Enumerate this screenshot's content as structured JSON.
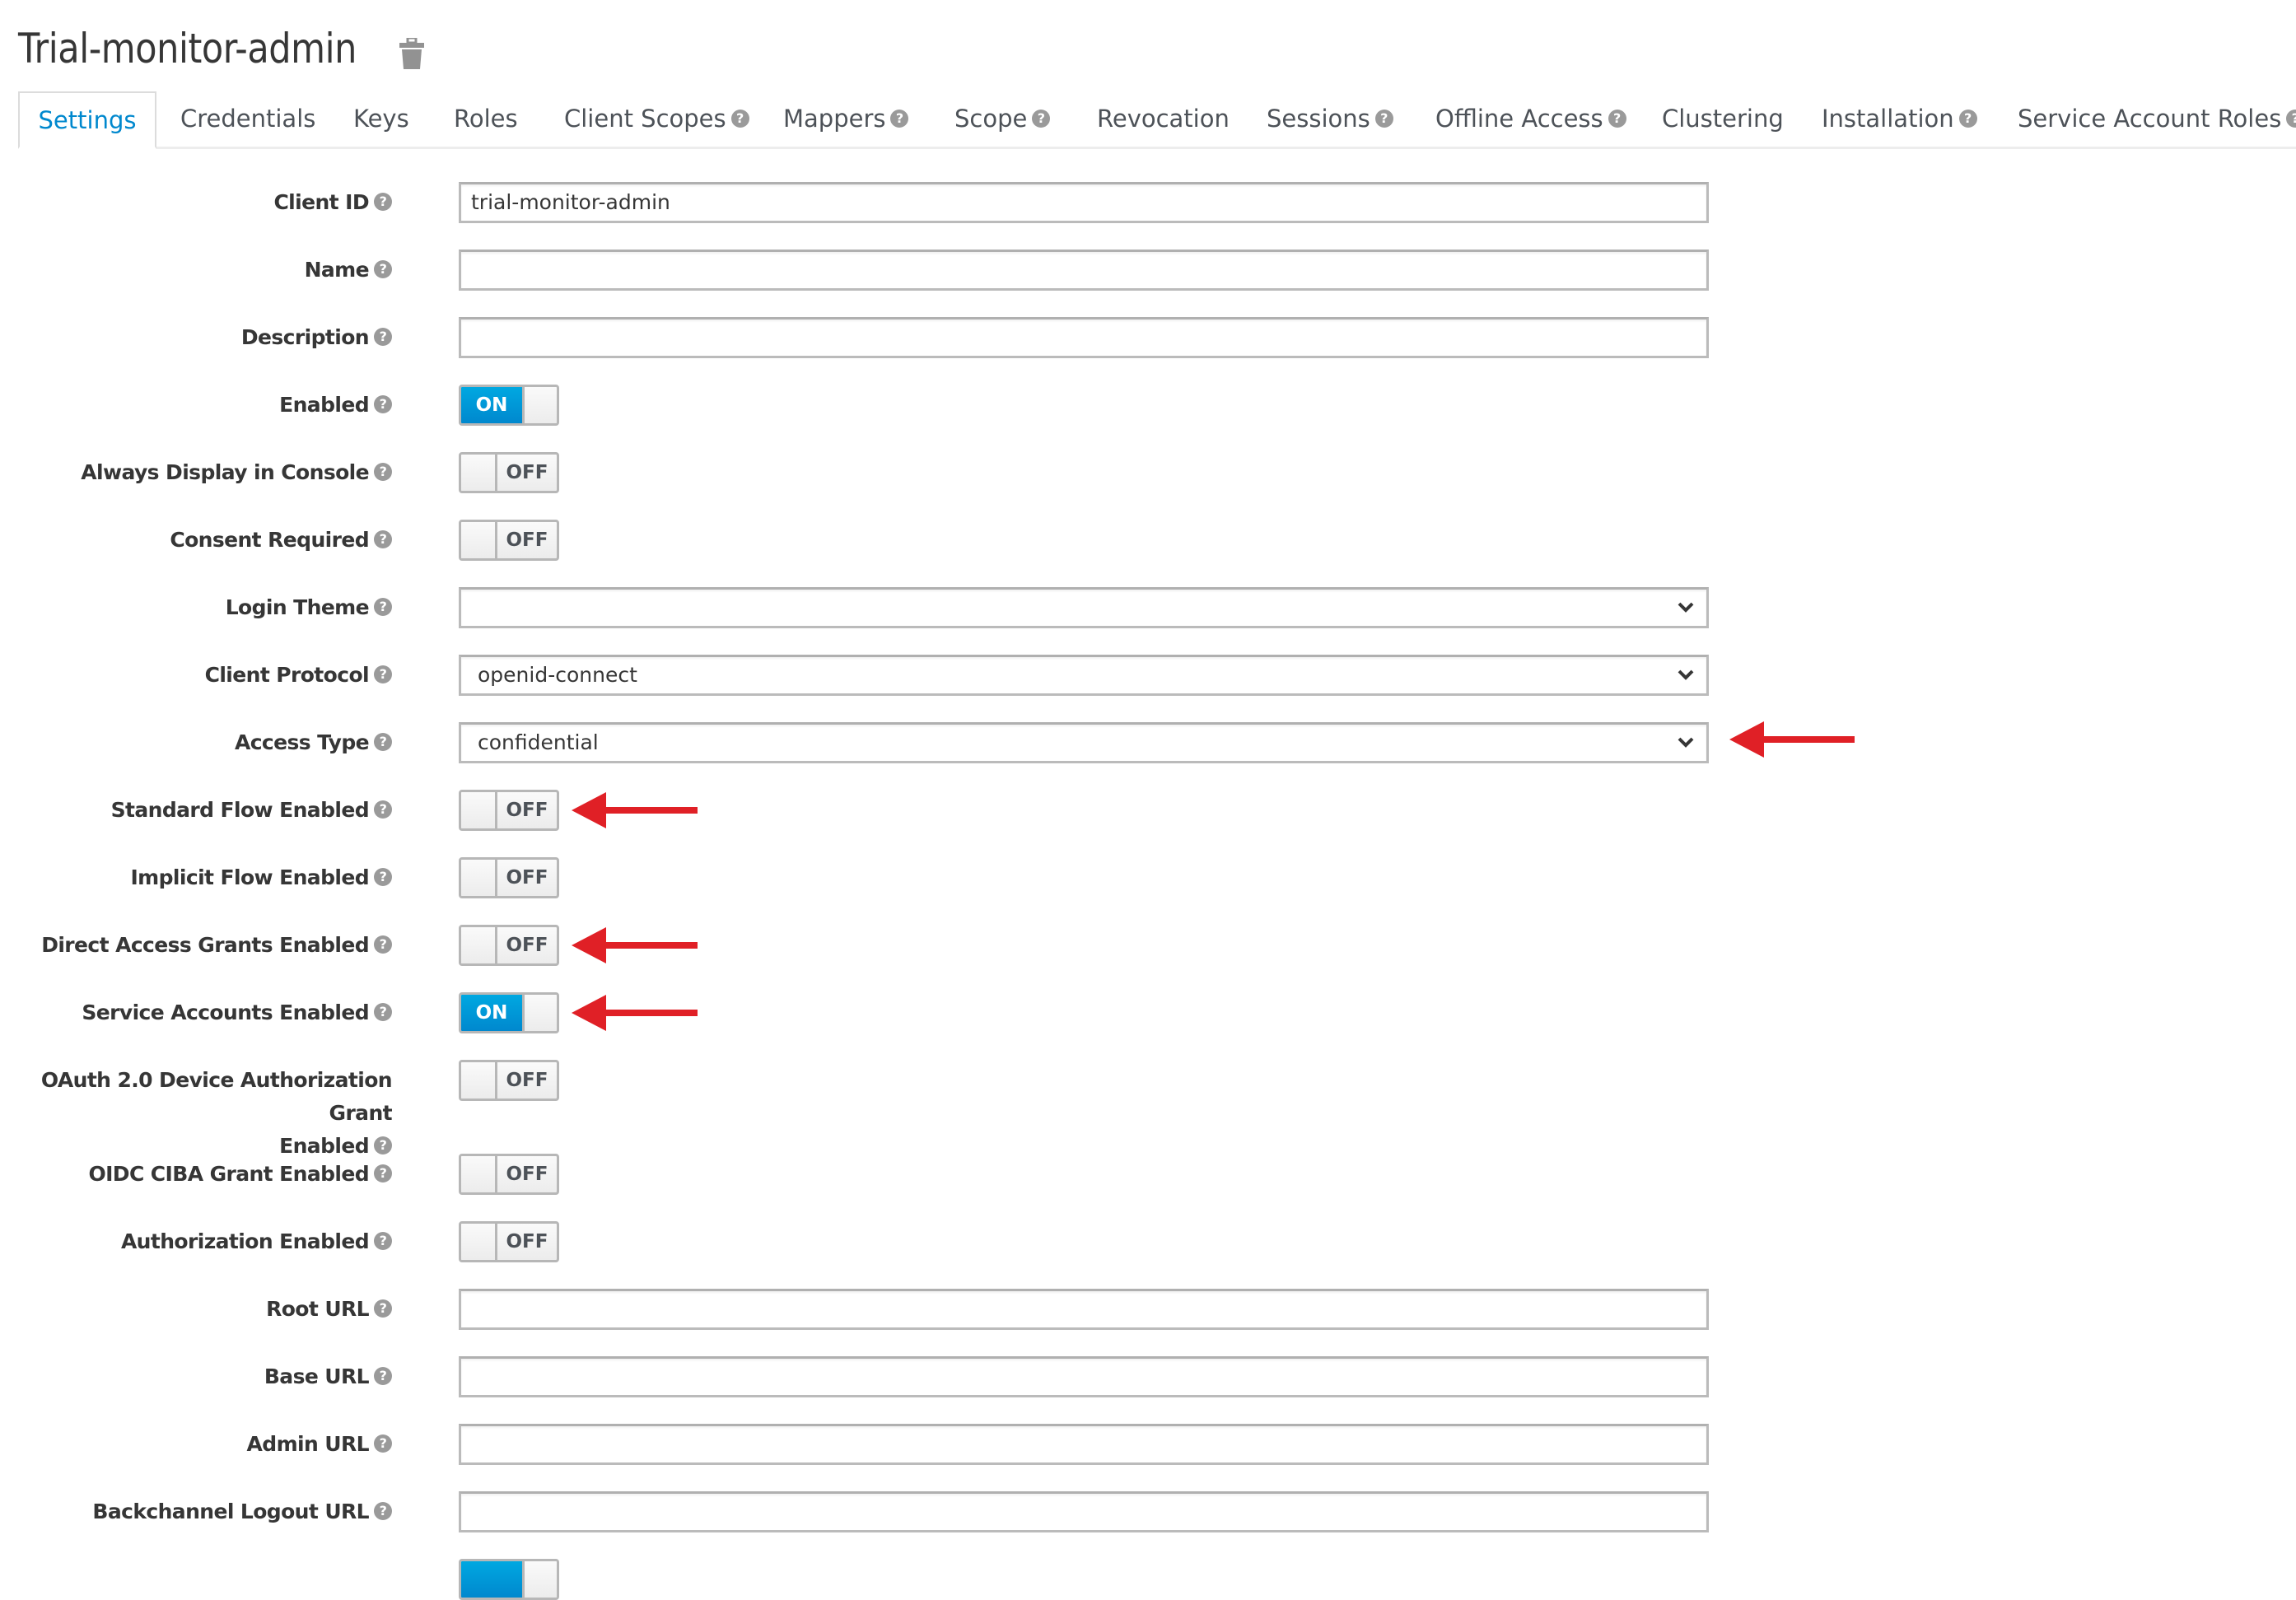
{
  "header": {
    "title": "Trial-monitor-admin",
    "delete_icon": "trash-icon"
  },
  "tabs": [
    {
      "label": "Settings",
      "active": true,
      "help": false
    },
    {
      "label": "Credentials",
      "active": false,
      "help": false
    },
    {
      "label": "Keys",
      "active": false,
      "help": false
    },
    {
      "label": "Roles",
      "active": false,
      "help": false
    },
    {
      "label": "Client Scopes",
      "active": false,
      "help": true
    },
    {
      "label": "Mappers",
      "active": false,
      "help": true
    },
    {
      "label": "Scope",
      "active": false,
      "help": true
    },
    {
      "label": "Revocation",
      "active": false,
      "help": false
    },
    {
      "label": "Sessions",
      "active": false,
      "help": true
    },
    {
      "label": "Offline Access",
      "active": false,
      "help": true
    },
    {
      "label": "Clustering",
      "active": false,
      "help": false
    },
    {
      "label": "Installation",
      "active": false,
      "help": true
    },
    {
      "label": "Service Account Roles",
      "active": false,
      "help": true
    }
  ],
  "help_glyph": "?",
  "toggle_labels": {
    "on": "ON",
    "off": "OFF"
  },
  "colors": {
    "accent": "#0088ce",
    "annotation_arrow": "#e02026",
    "help_icon": "#9a9a9a"
  },
  "form": {
    "client_id": {
      "label": "Client ID",
      "value": "trial-monitor-admin"
    },
    "name": {
      "label": "Name",
      "value": ""
    },
    "description": {
      "label": "Description",
      "value": ""
    },
    "enabled": {
      "label": "Enabled",
      "state": "ON"
    },
    "always_display": {
      "label": "Always Display in Console",
      "state": "OFF"
    },
    "consent_required": {
      "label": "Consent Required",
      "state": "OFF"
    },
    "login_theme": {
      "label": "Login Theme",
      "value": ""
    },
    "client_protocol": {
      "label": "Client Protocol",
      "value": "openid-connect"
    },
    "access_type": {
      "label": "Access Type",
      "value": "confidential",
      "annotated": true
    },
    "standard_flow": {
      "label": "Standard Flow Enabled",
      "state": "OFF",
      "annotated": true
    },
    "implicit_flow": {
      "label": "Implicit Flow Enabled",
      "state": "OFF"
    },
    "direct_access": {
      "label": "Direct Access Grants Enabled",
      "state": "OFF",
      "annotated": true
    },
    "service_accounts": {
      "label": "Service Accounts Enabled",
      "state": "ON",
      "annotated": true
    },
    "oauth_device": {
      "label_line1": "OAuth 2.0 Device Authorization Grant",
      "label_line2": "Enabled",
      "state": "OFF"
    },
    "oidc_ciba": {
      "label": "OIDC CIBA Grant Enabled",
      "state": "OFF"
    },
    "authorization": {
      "label": "Authorization Enabled",
      "state": "OFF"
    },
    "root_url": {
      "label": "Root URL",
      "value": ""
    },
    "base_url": {
      "label": "Base URL",
      "value": ""
    },
    "admin_url": {
      "label": "Admin URL",
      "value": ""
    },
    "backchannel_logout_url": {
      "label": "Backchannel Logout URL",
      "value": ""
    },
    "next_toggle_partial": {
      "state": "ON"
    }
  }
}
